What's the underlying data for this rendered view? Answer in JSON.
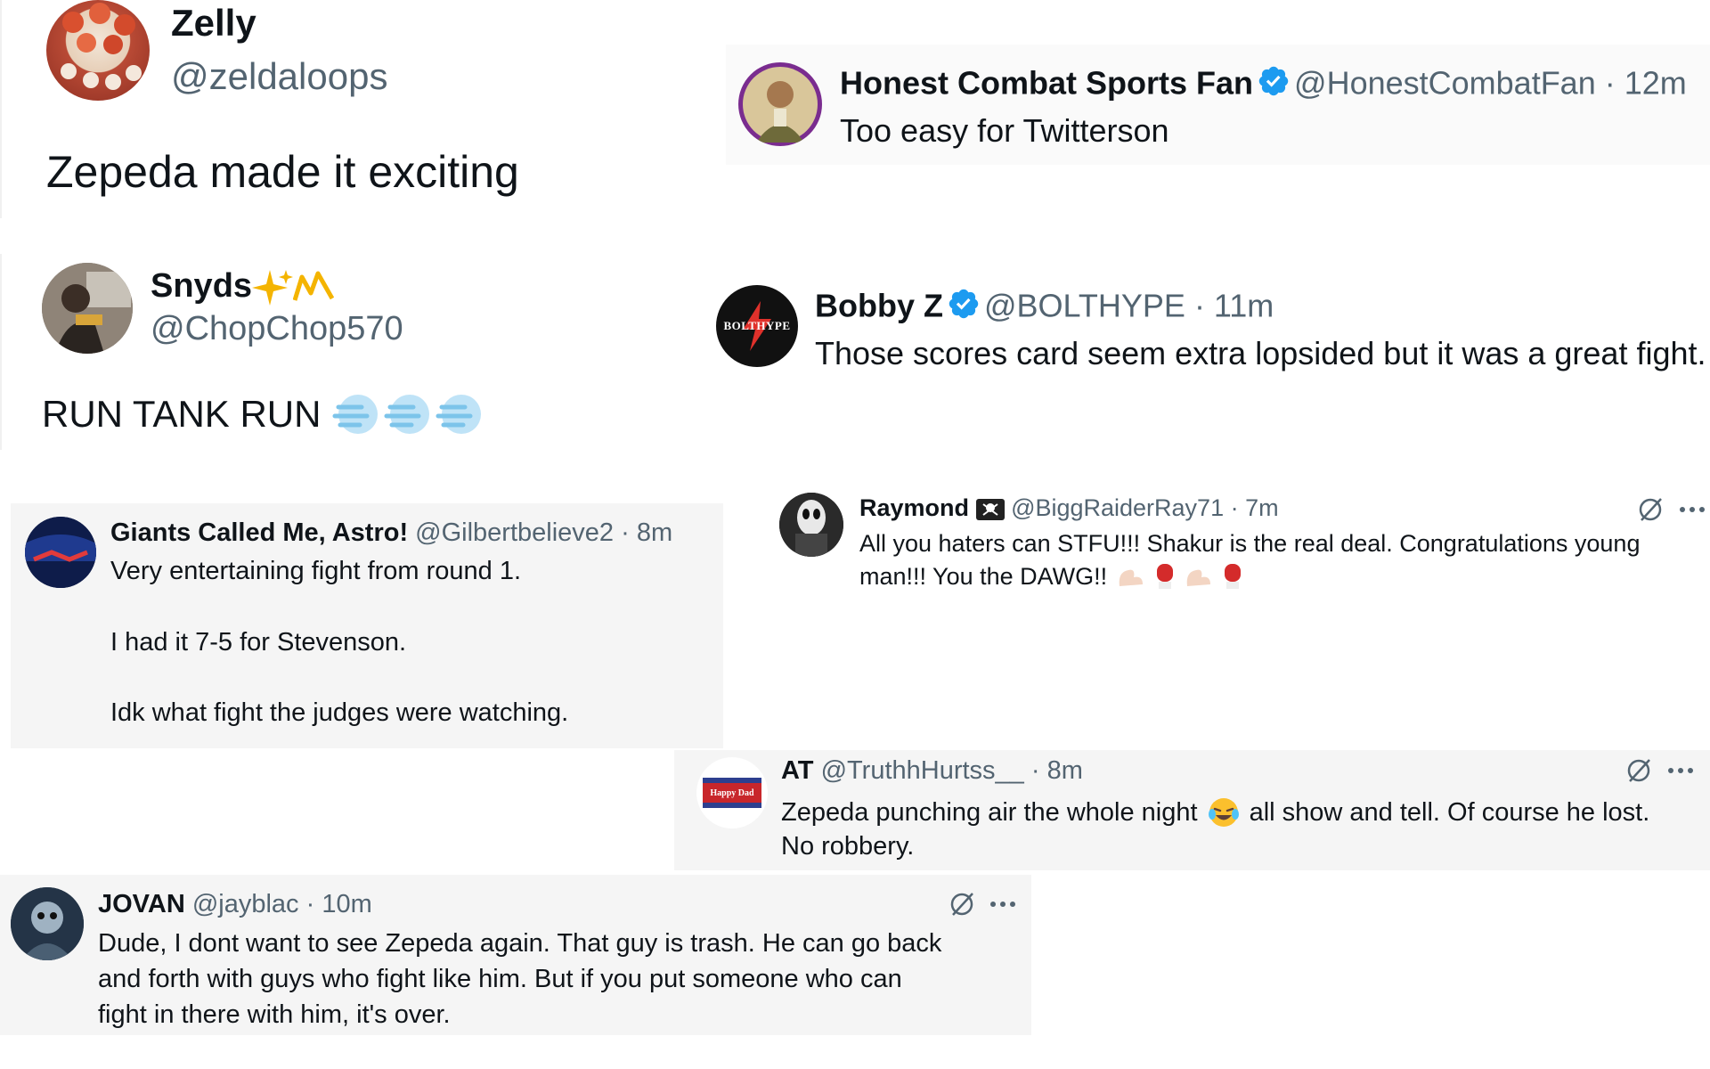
{
  "tweets": {
    "zelly": {
      "name": "Zelly",
      "handle": "@zeldaloops",
      "text": "Zepeda made it exciting"
    },
    "honest": {
      "name": "Honest Combat Sports Fan",
      "handle": "@HonestCombatFan",
      "time": "· 12m",
      "text": "Too easy for Twitterson"
    },
    "snyds": {
      "name": "Snyds",
      "handle": "@ChopChop570",
      "text": "RUN TANK RUN"
    },
    "bobby": {
      "name": "Bobby Z",
      "handle": "@BOLTHYPE",
      "time": "· 11m",
      "text": "Those scores card seem extra lopsided but it was a great fight.",
      "avatar_text": "BOLTHYPE"
    },
    "giants": {
      "name": "Giants Called Me, Astro!",
      "handle": "@Gilbertbelieve2",
      "time": "· 8m",
      "line1": "Very entertaining fight from round 1.",
      "line2": "I had it 7-5 for Stevenson.",
      "line3": "Idk what fight the judges were watching."
    },
    "raymond": {
      "name": "Raymond",
      "handle": "@BiggRaiderRay71",
      "time": "· 7m",
      "line1": "All you haters can STFU!!! Shakur is the real deal. Congratulations young",
      "line2": "man!!! You the DAWG!!"
    },
    "at": {
      "name": "AT",
      "handle": "@TruthhHurtss__",
      "time": "· 8m",
      "line1a": "Zepeda punching air the whole night",
      "line1b": "all show and tell. Of course he lost.",
      "line2": "No robbery.",
      "avatar_text": "Happy Dad"
    },
    "jovan": {
      "name": "JOVAN",
      "handle": "@jayblac",
      "time": "· 10m",
      "line1": "Dude, I dont want to see Zepeda again. That guy is trash. He can go back",
      "line2": "and forth with guys who fight like him. But if you put someone who can",
      "line3": "fight in there with him, it's over."
    }
  },
  "colors": {
    "verified": "#1d9bf0",
    "text": "#0f1419",
    "muted": "#536471",
    "card_gray": "#f5f5f5"
  },
  "icons": [
    "verified-icon",
    "grok-icon",
    "more-icon",
    "wind-emoji",
    "muscle-emoji",
    "boxing-glove-emoji",
    "laughing-emoji",
    "sparkles-emoji"
  ]
}
